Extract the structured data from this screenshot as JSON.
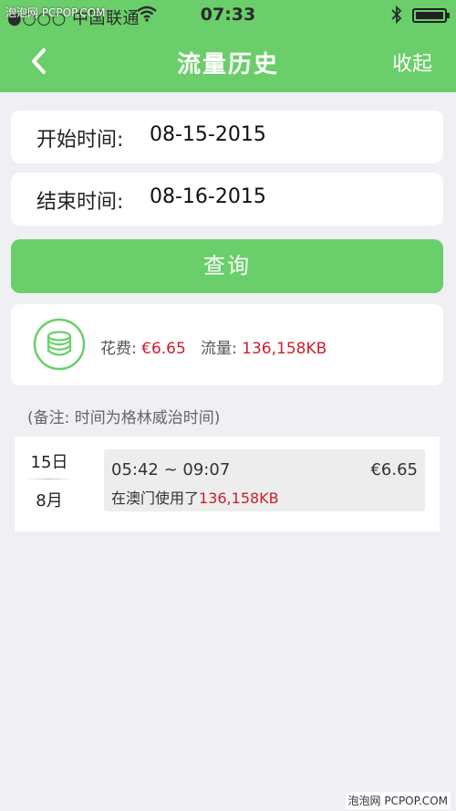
{
  "watermark": "泡泡网 PCPOP.COM",
  "status_bar": {
    "carrier": "●○○○ 中国联通",
    "time": "07:33",
    "wifi_icon": "wifi-icon",
    "bluetooth_icon": "bluetooth-icon",
    "battery_icon": "battery-icon"
  },
  "nav": {
    "back_icon": "chevron-left-icon",
    "title": "流量历史",
    "action": "收起"
  },
  "query": {
    "start_label": "开始时间:",
    "start_value": "08-15-2015",
    "end_label": "结束时间:",
    "end_value": "08-16-2015",
    "button_label": "查询"
  },
  "summary": {
    "icon": "coins-stack-icon",
    "cost_label": "花费: ",
    "cost_value": "€6.65",
    "usage_label": "流量: ",
    "usage_value": "136,158KB"
  },
  "note": "(备注: 时间为格林威治时间)",
  "records": [
    {
      "day": "15日",
      "month": "8月",
      "time_range": "05:42 ~ 09:07",
      "cost": "€6.65",
      "usage_prefix": "在澳门使用了",
      "usage_value": "136,158KB"
    }
  ],
  "footer_watermark": "泡泡网 PCPOP.COM",
  "colors": {
    "accent_green": "#6ace6a",
    "highlight_red": "#cc1e2d",
    "background": "#efeff4"
  }
}
